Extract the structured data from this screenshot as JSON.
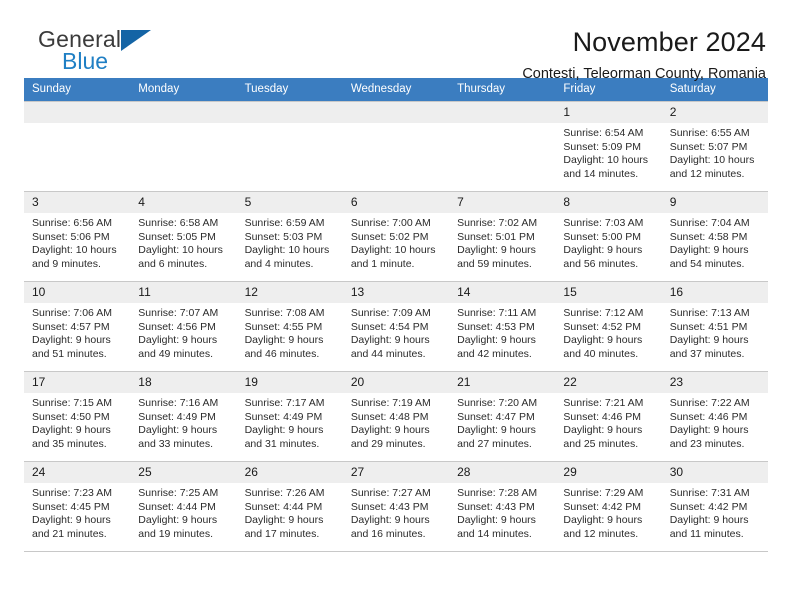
{
  "brand": {
    "name_part1": "General",
    "name_part2": "Blue",
    "triangle_icon": "triangle-icon"
  },
  "header": {
    "title": "November 2024",
    "subtitle": "Contesti, Teleorman County, Romania"
  },
  "colors": {
    "header_blue": "#3b7dc0",
    "brand_blue": "#1f7fc4",
    "logo_triangle": "#1464a5",
    "daynum_band": "#eeeeee",
    "grid_line": "#c8c8c8"
  },
  "weekdays": [
    "Sunday",
    "Monday",
    "Tuesday",
    "Wednesday",
    "Thursday",
    "Friday",
    "Saturday"
  ],
  "weeks": [
    [
      {
        "day": "",
        "empty": true
      },
      {
        "day": "",
        "empty": true
      },
      {
        "day": "",
        "empty": true
      },
      {
        "day": "",
        "empty": true
      },
      {
        "day": "",
        "empty": true
      },
      {
        "day": "1",
        "sunrise": "Sunrise: 6:54 AM",
        "sunset": "Sunset: 5:09 PM",
        "daylight": "Daylight: 10 hours and 14 minutes."
      },
      {
        "day": "2",
        "sunrise": "Sunrise: 6:55 AM",
        "sunset": "Sunset: 5:07 PM",
        "daylight": "Daylight: 10 hours and 12 minutes."
      }
    ],
    [
      {
        "day": "3",
        "sunrise": "Sunrise: 6:56 AM",
        "sunset": "Sunset: 5:06 PM",
        "daylight": "Daylight: 10 hours and 9 minutes."
      },
      {
        "day": "4",
        "sunrise": "Sunrise: 6:58 AM",
        "sunset": "Sunset: 5:05 PM",
        "daylight": "Daylight: 10 hours and 6 minutes."
      },
      {
        "day": "5",
        "sunrise": "Sunrise: 6:59 AM",
        "sunset": "Sunset: 5:03 PM",
        "daylight": "Daylight: 10 hours and 4 minutes."
      },
      {
        "day": "6",
        "sunrise": "Sunrise: 7:00 AM",
        "sunset": "Sunset: 5:02 PM",
        "daylight": "Daylight: 10 hours and 1 minute."
      },
      {
        "day": "7",
        "sunrise": "Sunrise: 7:02 AM",
        "sunset": "Sunset: 5:01 PM",
        "daylight": "Daylight: 9 hours and 59 minutes."
      },
      {
        "day": "8",
        "sunrise": "Sunrise: 7:03 AM",
        "sunset": "Sunset: 5:00 PM",
        "daylight": "Daylight: 9 hours and 56 minutes."
      },
      {
        "day": "9",
        "sunrise": "Sunrise: 7:04 AM",
        "sunset": "Sunset: 4:58 PM",
        "daylight": "Daylight: 9 hours and 54 minutes."
      }
    ],
    [
      {
        "day": "10",
        "sunrise": "Sunrise: 7:06 AM",
        "sunset": "Sunset: 4:57 PM",
        "daylight": "Daylight: 9 hours and 51 minutes."
      },
      {
        "day": "11",
        "sunrise": "Sunrise: 7:07 AM",
        "sunset": "Sunset: 4:56 PM",
        "daylight": "Daylight: 9 hours and 49 minutes."
      },
      {
        "day": "12",
        "sunrise": "Sunrise: 7:08 AM",
        "sunset": "Sunset: 4:55 PM",
        "daylight": "Daylight: 9 hours and 46 minutes."
      },
      {
        "day": "13",
        "sunrise": "Sunrise: 7:09 AM",
        "sunset": "Sunset: 4:54 PM",
        "daylight": "Daylight: 9 hours and 44 minutes."
      },
      {
        "day": "14",
        "sunrise": "Sunrise: 7:11 AM",
        "sunset": "Sunset: 4:53 PM",
        "daylight": "Daylight: 9 hours and 42 minutes."
      },
      {
        "day": "15",
        "sunrise": "Sunrise: 7:12 AM",
        "sunset": "Sunset: 4:52 PM",
        "daylight": "Daylight: 9 hours and 40 minutes."
      },
      {
        "day": "16",
        "sunrise": "Sunrise: 7:13 AM",
        "sunset": "Sunset: 4:51 PM",
        "daylight": "Daylight: 9 hours and 37 minutes."
      }
    ],
    [
      {
        "day": "17",
        "sunrise": "Sunrise: 7:15 AM",
        "sunset": "Sunset: 4:50 PM",
        "daylight": "Daylight: 9 hours and 35 minutes."
      },
      {
        "day": "18",
        "sunrise": "Sunrise: 7:16 AM",
        "sunset": "Sunset: 4:49 PM",
        "daylight": "Daylight: 9 hours and 33 minutes."
      },
      {
        "day": "19",
        "sunrise": "Sunrise: 7:17 AM",
        "sunset": "Sunset: 4:49 PM",
        "daylight": "Daylight: 9 hours and 31 minutes."
      },
      {
        "day": "20",
        "sunrise": "Sunrise: 7:19 AM",
        "sunset": "Sunset: 4:48 PM",
        "daylight": "Daylight: 9 hours and 29 minutes."
      },
      {
        "day": "21",
        "sunrise": "Sunrise: 7:20 AM",
        "sunset": "Sunset: 4:47 PM",
        "daylight": "Daylight: 9 hours and 27 minutes."
      },
      {
        "day": "22",
        "sunrise": "Sunrise: 7:21 AM",
        "sunset": "Sunset: 4:46 PM",
        "daylight": "Daylight: 9 hours and 25 minutes."
      },
      {
        "day": "23",
        "sunrise": "Sunrise: 7:22 AM",
        "sunset": "Sunset: 4:46 PM",
        "daylight": "Daylight: 9 hours and 23 minutes."
      }
    ],
    [
      {
        "day": "24",
        "sunrise": "Sunrise: 7:23 AM",
        "sunset": "Sunset: 4:45 PM",
        "daylight": "Daylight: 9 hours and 21 minutes."
      },
      {
        "day": "25",
        "sunrise": "Sunrise: 7:25 AM",
        "sunset": "Sunset: 4:44 PM",
        "daylight": "Daylight: 9 hours and 19 minutes."
      },
      {
        "day": "26",
        "sunrise": "Sunrise: 7:26 AM",
        "sunset": "Sunset: 4:44 PM",
        "daylight": "Daylight: 9 hours and 17 minutes."
      },
      {
        "day": "27",
        "sunrise": "Sunrise: 7:27 AM",
        "sunset": "Sunset: 4:43 PM",
        "daylight": "Daylight: 9 hours and 16 minutes."
      },
      {
        "day": "28",
        "sunrise": "Sunrise: 7:28 AM",
        "sunset": "Sunset: 4:43 PM",
        "daylight": "Daylight: 9 hours and 14 minutes."
      },
      {
        "day": "29",
        "sunrise": "Sunrise: 7:29 AM",
        "sunset": "Sunset: 4:42 PM",
        "daylight": "Daylight: 9 hours and 12 minutes."
      },
      {
        "day": "30",
        "sunrise": "Sunrise: 7:31 AM",
        "sunset": "Sunset: 4:42 PM",
        "daylight": "Daylight: 9 hours and 11 minutes."
      }
    ]
  ]
}
